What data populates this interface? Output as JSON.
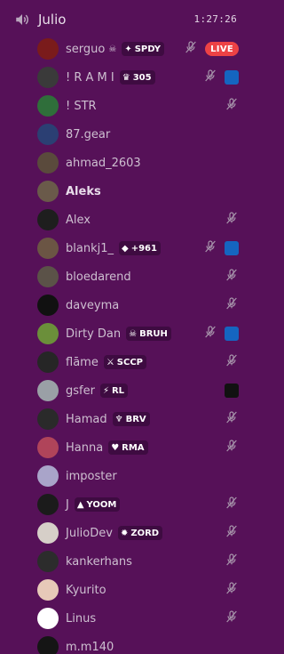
{
  "channel": {
    "name": "Julio",
    "timer": "1:27:26"
  },
  "users": [
    {
      "name": "serguo",
      "deco": "☠",
      "tag": {
        "icon": "✦",
        "text": "SPDY"
      },
      "muted": true,
      "live": "LIVE",
      "rl": false,
      "mask": false,
      "avatar": "#7a1b1b",
      "bold": false
    },
    {
      "name": "! R A M I",
      "deco": "",
      "tag": {
        "icon": "♛",
        "text": "305"
      },
      "muted": true,
      "live": "",
      "rl": true,
      "mask": false,
      "avatar": "#3a3a3a",
      "bold": false
    },
    {
      "name": "! STR",
      "deco": "",
      "tag": null,
      "muted": true,
      "live": "",
      "rl": false,
      "mask": false,
      "avatar": "#2f6e3a",
      "bold": false
    },
    {
      "name": "87.gear",
      "deco": "",
      "tag": null,
      "muted": false,
      "live": "",
      "rl": false,
      "mask": false,
      "avatar": "#2b3f73",
      "bold": false
    },
    {
      "name": "ahmad_2603",
      "deco": "",
      "tag": null,
      "muted": false,
      "live": "",
      "rl": false,
      "mask": false,
      "avatar": "#5a4a3c",
      "bold": false
    },
    {
      "name": "Aleks",
      "deco": "",
      "tag": null,
      "muted": false,
      "live": "",
      "rl": false,
      "mask": false,
      "avatar": "#6a5a4a",
      "bold": true
    },
    {
      "name": "Alex",
      "deco": "",
      "tag": null,
      "muted": true,
      "live": "",
      "rl": false,
      "mask": false,
      "avatar": "#1e1e1e",
      "bold": false
    },
    {
      "name": "blankj1_",
      "deco": "",
      "tag": {
        "icon": "◆",
        "text": "+961"
      },
      "muted": true,
      "live": "",
      "rl": true,
      "mask": false,
      "avatar": "#6b5544",
      "bold": false
    },
    {
      "name": "bloedarend",
      "deco": "",
      "tag": null,
      "muted": true,
      "live": "",
      "rl": false,
      "mask": false,
      "avatar": "#5b5248",
      "bold": false
    },
    {
      "name": "daveyma",
      "deco": "",
      "tag": null,
      "muted": true,
      "live": "",
      "rl": false,
      "mask": false,
      "avatar": "#111111",
      "bold": false
    },
    {
      "name": "Dirty Dan",
      "deco": "",
      "tag": {
        "icon": "☠",
        "text": "BRUH"
      },
      "muted": true,
      "live": "",
      "rl": true,
      "mask": false,
      "avatar": "#6b8f3a",
      "bold": false
    },
    {
      "name": "flāme",
      "deco": "",
      "tag": {
        "icon": "⚔",
        "text": "SCCP"
      },
      "muted": true,
      "live": "",
      "rl": false,
      "mask": false,
      "avatar": "#262626",
      "bold": false
    },
    {
      "name": "gsfer",
      "deco": "",
      "tag": {
        "icon": "⚡",
        "text": "RL"
      },
      "muted": false,
      "live": "",
      "rl": false,
      "mask": true,
      "avatar": "#9aa0a6",
      "bold": false
    },
    {
      "name": "Hamad",
      "deco": "",
      "tag": {
        "icon": "♆",
        "text": "BRV"
      },
      "muted": true,
      "live": "",
      "rl": false,
      "mask": false,
      "avatar": "#2a2a2a",
      "bold": false
    },
    {
      "name": "Hanna",
      "deco": "",
      "tag": {
        "icon": "♥",
        "text": "RMA"
      },
      "muted": true,
      "live": "",
      "rl": false,
      "mask": false,
      "avatar": "#b0445a",
      "bold": false
    },
    {
      "name": "imposter",
      "deco": "",
      "tag": null,
      "muted": false,
      "live": "",
      "rl": false,
      "mask": false,
      "avatar": "#a9a4c9",
      "bold": false
    },
    {
      "name": "J",
      "deco": "",
      "tag": {
        "icon": "▲",
        "text": "YOOM"
      },
      "muted": true,
      "live": "",
      "rl": false,
      "mask": false,
      "avatar": "#1b1b1b",
      "bold": false
    },
    {
      "name": "JulioDev",
      "deco": "",
      "tag": {
        "icon": "✹",
        "text": "ZORD"
      },
      "muted": true,
      "live": "",
      "rl": false,
      "mask": false,
      "avatar": "#d6cfc8",
      "bold": false
    },
    {
      "name": "kankerhans",
      "deco": "",
      "tag": null,
      "muted": true,
      "live": "",
      "rl": false,
      "mask": false,
      "avatar": "#2c2c2c",
      "bold": false
    },
    {
      "name": "Kyurito",
      "deco": "",
      "tag": null,
      "muted": true,
      "live": "",
      "rl": false,
      "mask": false,
      "avatar": "#e7c9b8",
      "bold": false
    },
    {
      "name": "Linus",
      "deco": "",
      "tag": null,
      "muted": true,
      "live": "",
      "rl": false,
      "mask": false,
      "avatar": "#ffffff",
      "bold": false
    },
    {
      "name": "m.m140",
      "deco": "",
      "tag": null,
      "muted": false,
      "live": "",
      "rl": false,
      "mask": false,
      "avatar": "#151515",
      "bold": false
    }
  ],
  "theme": {
    "background": "#561158",
    "tag_bg": "#3e0b41",
    "live": "#ed4245"
  },
  "icons": {
    "speaker": "speaker-icon",
    "muted": "mic-muted-icon",
    "game": "rocket-league-icon"
  }
}
